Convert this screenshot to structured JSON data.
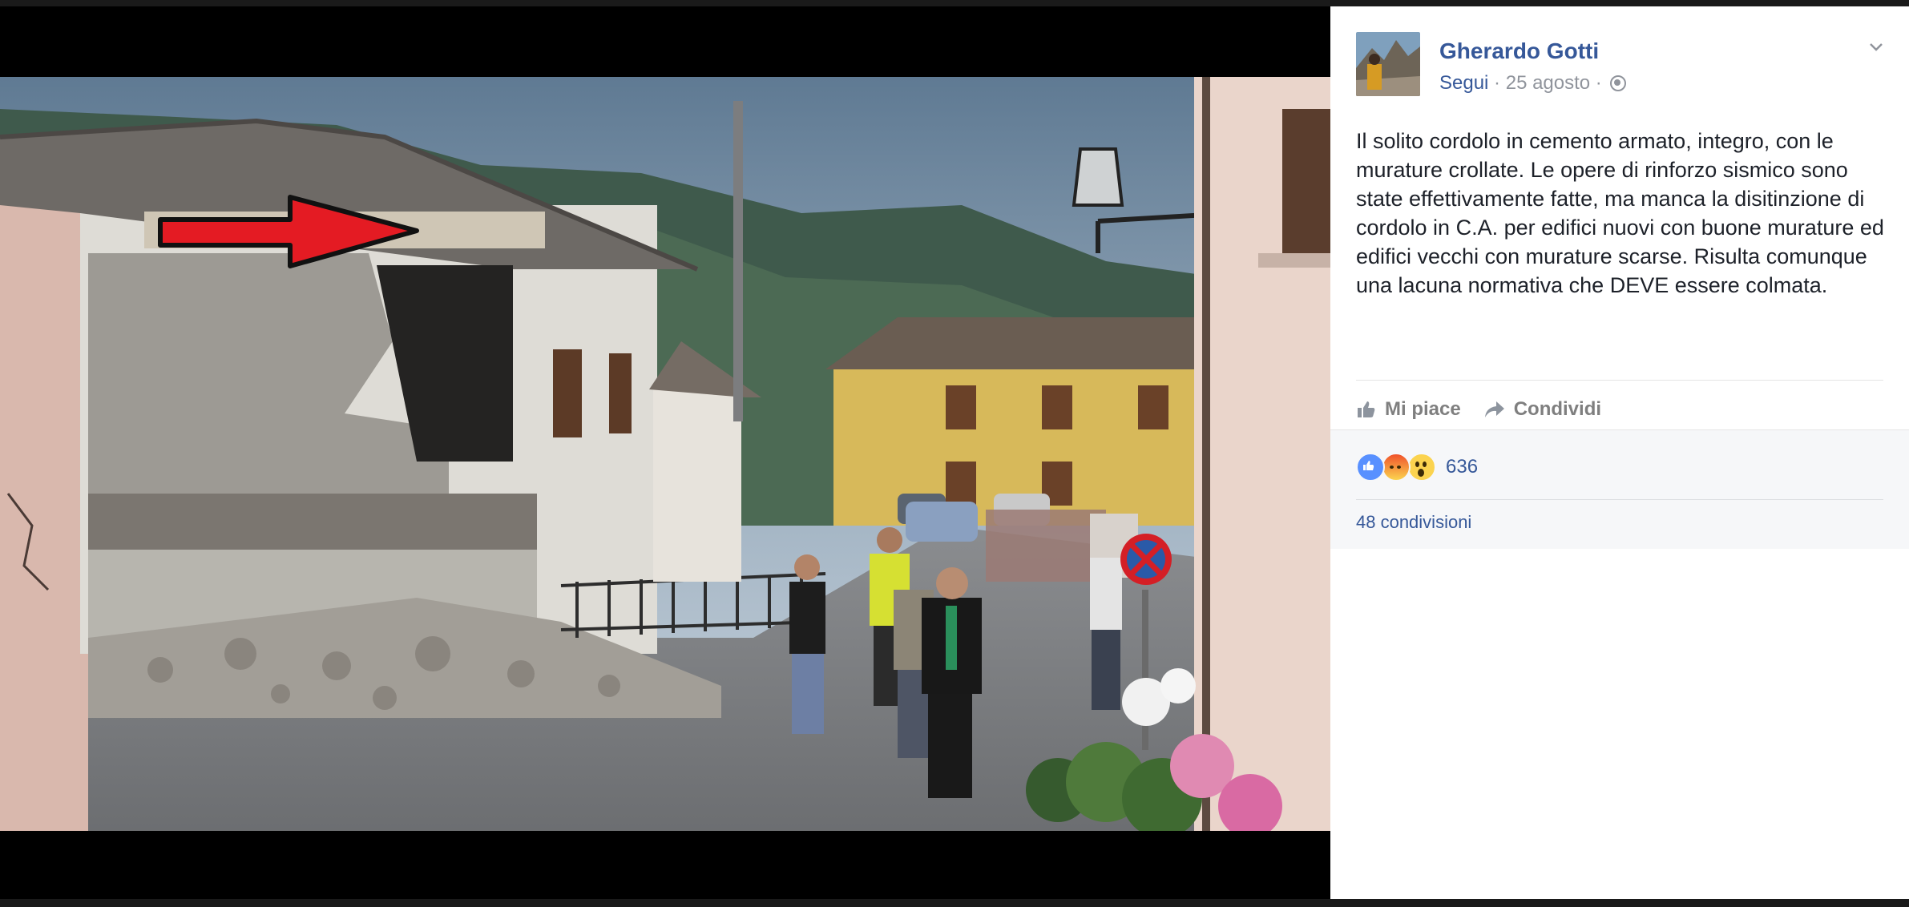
{
  "post": {
    "author": "Gherardo Gotti",
    "follow_label": "Segui",
    "date": "25 agosto",
    "dot1": " · ",
    "dot2": " · ",
    "text": "Il solito cordolo in cemento armato, integro, con le murature crollate. Le opere di rinforzo sismico sono state effettivamente fatte, ma manca la disitinzione di cordolo in C.A. per edifici nuovi con buone murature ed edifici vecchi con murature scarse. Risulta comunque una lacuna normativa che DEVE essere colmata."
  },
  "actions": {
    "like_label": "Mi piace",
    "share_label": "Condividi"
  },
  "reactions": {
    "icons": [
      "like-icon",
      "angry-icon",
      "wow-icon"
    ],
    "count": "636",
    "shares": "48 condivisioni"
  },
  "colors": {
    "link": "#365899",
    "meta": "#90949c",
    "arrow": "#e41b23",
    "like_blue": "#5890ff"
  }
}
